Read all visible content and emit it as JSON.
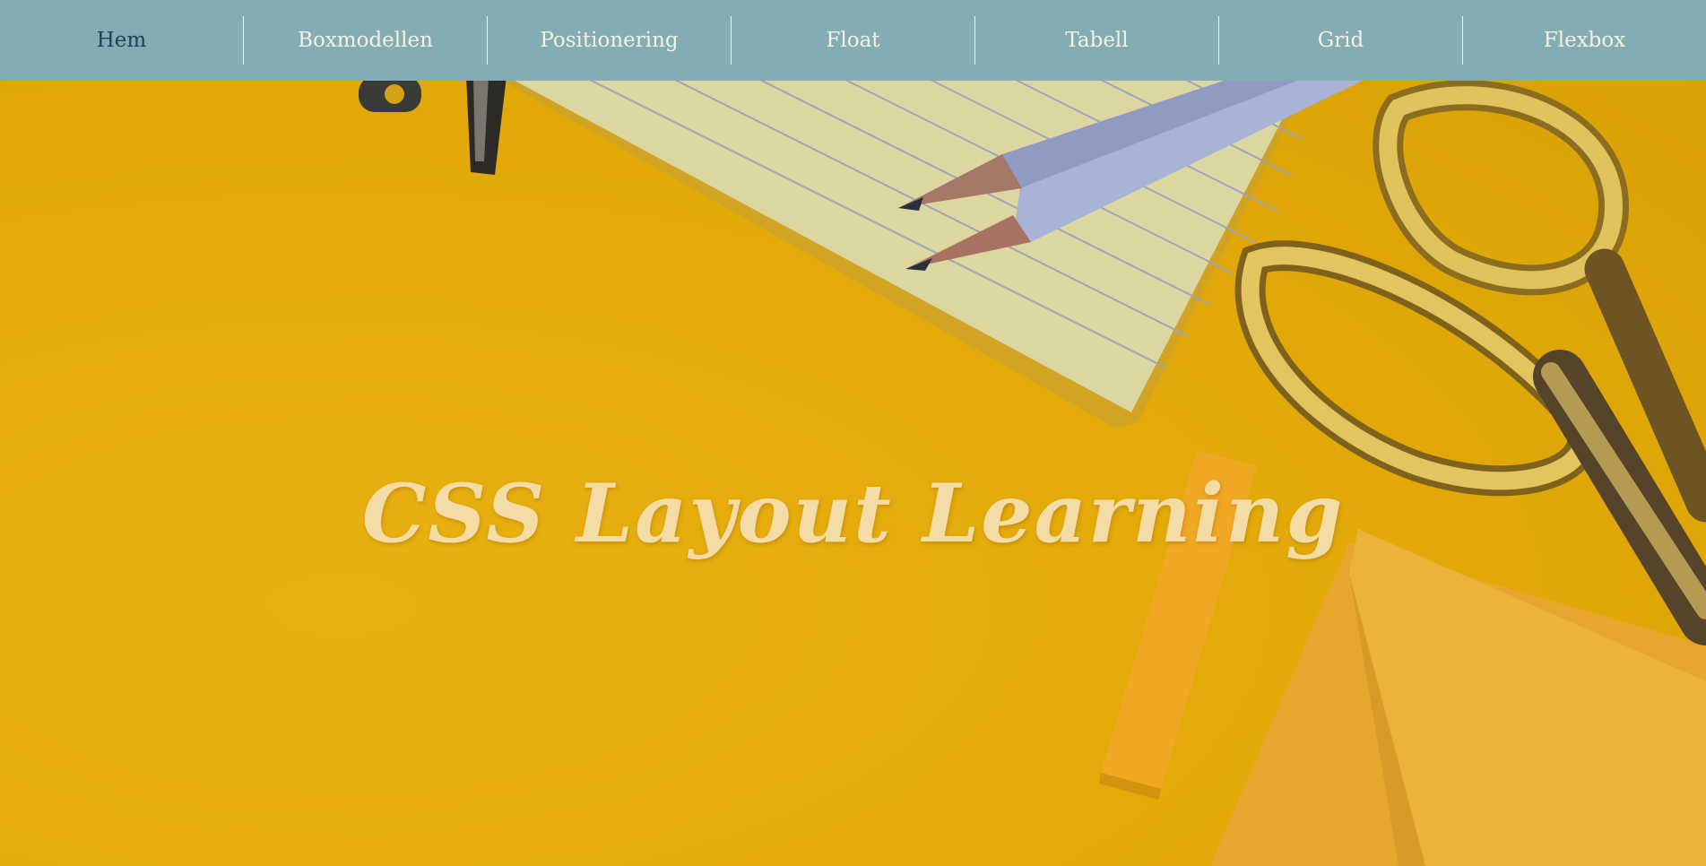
{
  "nav": {
    "items": [
      {
        "label": "Hem",
        "active": true
      },
      {
        "label": "Boxmodellen",
        "active": false
      },
      {
        "label": "Positionering",
        "active": false
      },
      {
        "label": "Float",
        "active": false
      },
      {
        "label": "Tabell",
        "active": false
      },
      {
        "label": "Grid",
        "active": false
      },
      {
        "label": "Flexbox",
        "active": false
      }
    ]
  },
  "hero": {
    "title": "CSS Layout Learning"
  },
  "colors": {
    "nav_background": "#84adb3",
    "nav_text": "#f4f1e6",
    "nav_active_text": "#1d3f5a",
    "hero_background": "#e5ad0a",
    "hero_title": "#f4dca6"
  }
}
